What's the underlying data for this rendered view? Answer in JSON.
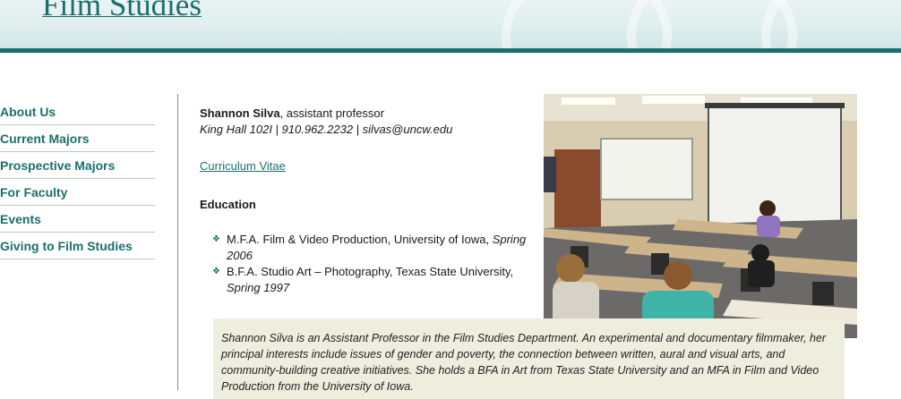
{
  "header": {
    "title": "Film Studies"
  },
  "sidebar": {
    "items": [
      {
        "label": "About Us"
      },
      {
        "label": "Current Majors"
      },
      {
        "label": "Prospective Majors"
      },
      {
        "label": "For Faculty"
      },
      {
        "label": "Events"
      },
      {
        "label": "Giving to Film Studies"
      }
    ]
  },
  "profile": {
    "name": "Shannon Silva",
    "title_suffix": ", assistant professor",
    "contact": "King Hall 102I | 910.962.2232 | silvas@uncw.edu",
    "cv_link": "Curriculum Vitae"
  },
  "education": {
    "heading": "Education",
    "items": [
      {
        "degree": "M.F.A.  Film & Video Production, University of Iowa, ",
        "year": "Spring 2006"
      },
      {
        "degree": "B.F.A.  Studio Art – Photography, Texas State University, ",
        "year": "Spring 1997"
      }
    ]
  },
  "bio": {
    "text": "Shannon Silva is an Assistant Professor in the Film Studies Department. An experimental and documentary filmmaker, her principal interests include issues of gender and poverty, the connection between written, aural and visual arts, and community-building creative initiatives. She holds a BFA in Art from Texas State University and an MFA in Film and Video Production from the University of Iowa."
  },
  "colors": {
    "accent": "#1b6f6b",
    "header_bar": "#17706c",
    "bio_bg": "#eeeedf"
  }
}
